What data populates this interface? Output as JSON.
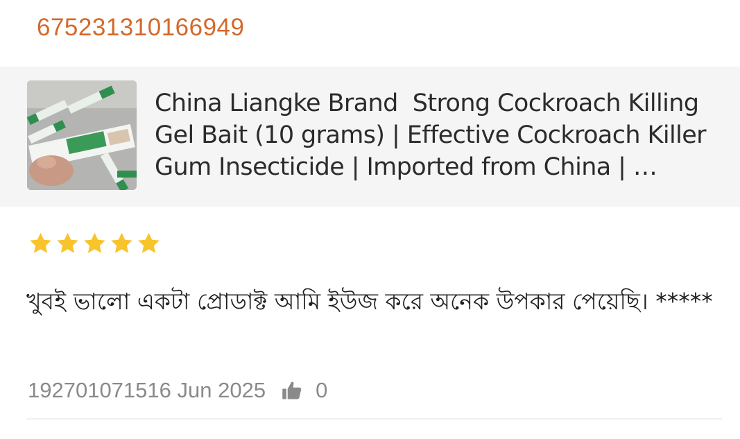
{
  "order": {
    "id": "675231310166949"
  },
  "product": {
    "title": "China Liangke Brand  Strong Cockroach Killing Gel Bait (10 grams) | Effective Cockroach Killer Gum Insecticide | Imported from China | Cockroach Killer Gel",
    "thumbnail_icon": "product-photo"
  },
  "review": {
    "rating": 5,
    "rating_max": 5,
    "star_color": "#F8C32B",
    "text": "খুবই ভালো একটা প্রোডাক্ট আমি ইউজ করে অনেক উপকার পেয়েছি। *****",
    "reviewer_and_date": "192701071516 Jun 2025",
    "likes": "0"
  },
  "colors": {
    "order_id": "#D4692A",
    "card_bg": "#F5F5F5"
  }
}
